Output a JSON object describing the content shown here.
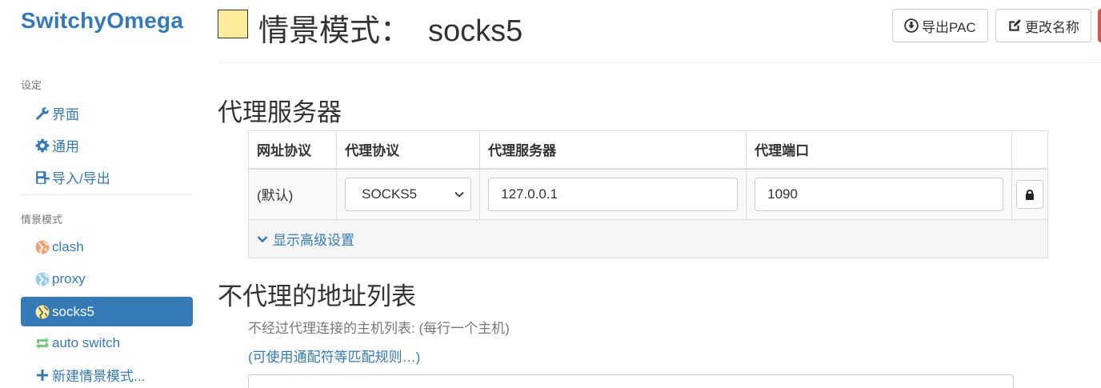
{
  "brand": "SwitchyOmega",
  "sidebar": {
    "settings_header": "设定",
    "settings_items": [
      {
        "label": "界面",
        "icon": "wrench-icon"
      },
      {
        "label": "通用",
        "icon": "gear-icon"
      },
      {
        "label": "导入/导出",
        "icon": "import-export-icon"
      }
    ],
    "profiles_header": "情景模式",
    "profile_items": [
      {
        "label": "clash",
        "icon": "globe-icon",
        "color": "#f0a070"
      },
      {
        "label": "proxy",
        "icon": "globe-icon",
        "color": "#99ccee"
      },
      {
        "label": "socks5",
        "icon": "globe-icon",
        "color": "#fdec9a",
        "active": true
      },
      {
        "label": "auto switch",
        "icon": "switch-arrows-icon",
        "color": "#99dd99"
      },
      {
        "label": "新建情景模式...",
        "icon": "plus-icon",
        "color": "#337ab7"
      }
    ]
  },
  "header": {
    "title_prefix": "情景模式：",
    "profile_name": "socks5",
    "profile_color": "#fdec9a",
    "export_pac_label": "导出PAC",
    "rename_label": "更改名称"
  },
  "proxy_section": {
    "title": "代理服务器",
    "columns": [
      "网址协议",
      "代理协议",
      "代理服务器",
      "代理端口"
    ],
    "row": {
      "scheme": "(默认)",
      "protocol": "SOCKS5",
      "server": "127.0.0.1",
      "port": "1090"
    },
    "advanced_label": "显示高级设置"
  },
  "bypass_section": {
    "title": "不代理的地址列表",
    "help": "不经过代理连接的主机列表: (每行一个主机)",
    "rules_link": "(可使用通配符等匹配规则…)"
  },
  "colors": {
    "accent": "#337ab7",
    "danger": "#d9534f"
  }
}
